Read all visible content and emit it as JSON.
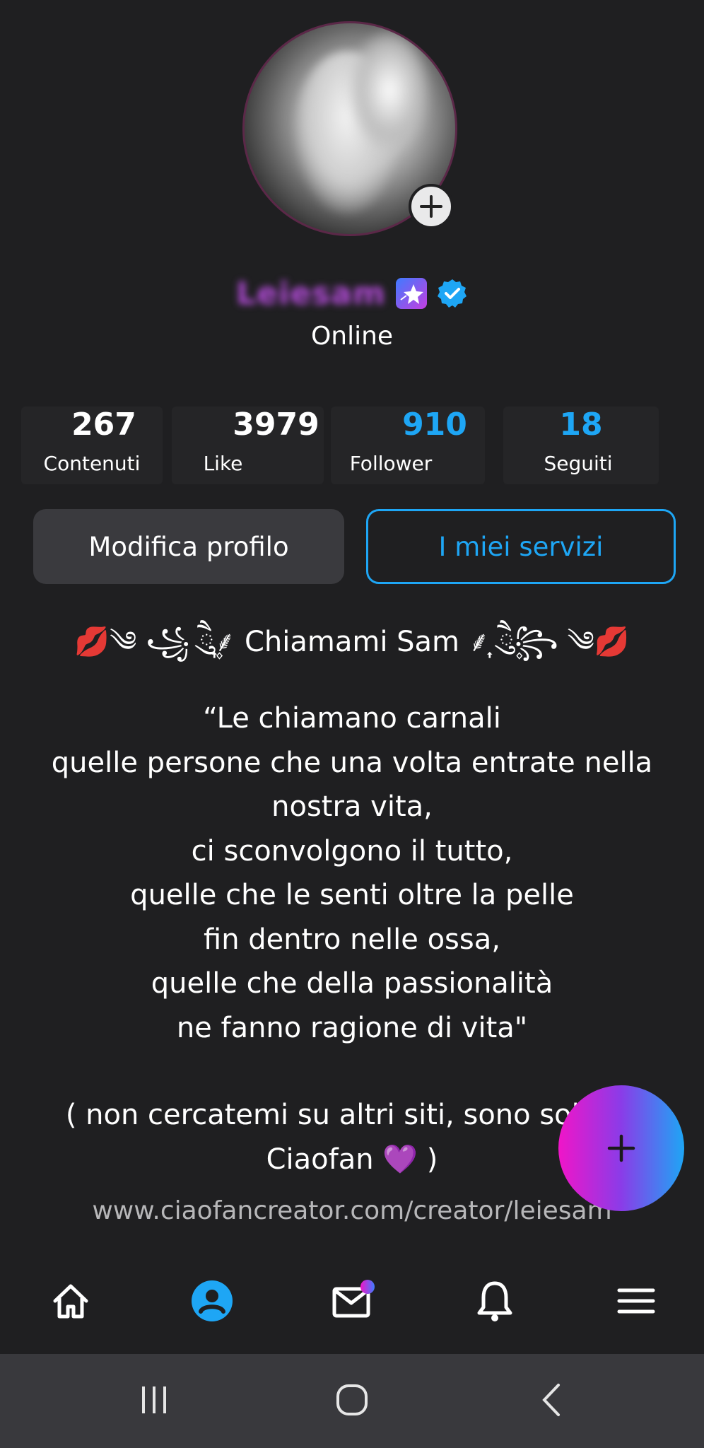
{
  "profile": {
    "username": "Leiesam",
    "status": "Online",
    "badges": [
      "star-badge-icon",
      "verified-icon"
    ]
  },
  "stats": [
    {
      "value": "267",
      "label": "Contenuti",
      "color": "#ffffff"
    },
    {
      "value": "3979",
      "label": "Like",
      "color": "#ffffff"
    },
    {
      "value": "910",
      "label": "Follower",
      "color": "#1ea6f5"
    },
    {
      "value": "18",
      "label": "Seguiti",
      "color": "#1ea6f5"
    }
  ],
  "buttons": {
    "edit_profile": "Modifica profilo",
    "my_services": "I miei servizi"
  },
  "bio": {
    "title": "💋༄ ꧁ ཻུ۪۪⸙͎ Chiamami Sam ⸙͎ ཻུ۪۪꧂ ༄💋",
    "quote": "“Le chiamano carnali\nquelle persone che una volta entrate nella nostra vita,\nci sconvolgono il tutto,\nquelle che le senti oltre la pelle\nfin dentro nelle ossa,\nquelle che della passionalità\nne fanno ragione di vita\"",
    "note": "( non cercatemi su altri siti, sono solo su\nCiaofan 💜 )",
    "link": "www.ciaofancreator.com/creator/leiesam"
  },
  "nav": {
    "items": [
      "home-icon",
      "profile-icon",
      "mail-icon",
      "bell-icon",
      "menu-icon"
    ],
    "active": "profile-icon",
    "accent": "#1ea6f5"
  },
  "system_nav": [
    "recent-apps-icon",
    "home-circle-icon",
    "back-icon"
  ]
}
